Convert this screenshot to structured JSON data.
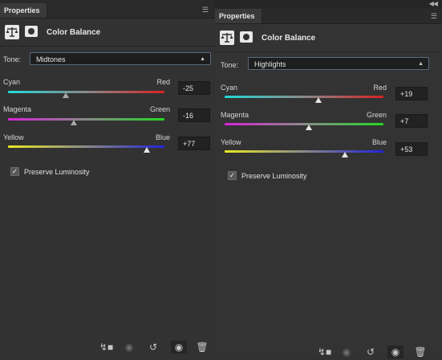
{
  "panels": [
    {
      "tab": "Properties",
      "title": "Color Balance",
      "tone_label": "Tone:",
      "tone_value": "Midtones",
      "sliders": [
        {
          "left": "Cyan",
          "right": "Red",
          "value": "-25",
          "position": -25
        },
        {
          "left": "Magenta",
          "right": "Green",
          "value": "-16",
          "position": -16
        },
        {
          "left": "Yellow",
          "right": "Blue",
          "value": "+77",
          "position": 77
        }
      ],
      "preserve_label": "Preserve Luminosity",
      "preserve_checked": true
    },
    {
      "tab": "Properties",
      "title": "Color Balance",
      "tone_label": "Tone:",
      "tone_value": "Highlights",
      "sliders": [
        {
          "left": "Cyan",
          "right": "Red",
          "value": "+19",
          "position": 19
        },
        {
          "left": "Magenta",
          "right": "Green",
          "value": "+7",
          "position": 7
        },
        {
          "left": "Yellow",
          "right": "Blue",
          "value": "+53",
          "position": 53
        }
      ],
      "preserve_label": "Preserve Luminosity",
      "preserve_checked": true
    }
  ],
  "footer_icons": [
    "clip-to-layer-icon",
    "view-previous-state-icon",
    "reset-icon",
    "visibility-eye-icon",
    "trash-icon"
  ],
  "colors": {
    "cyan_red": [
      "#22d8d8",
      "#d82222"
    ],
    "magenta_green": [
      "#d822d8",
      "#22d822"
    ],
    "yellow_blue": [
      "#e8e822",
      "#2222d8"
    ]
  }
}
